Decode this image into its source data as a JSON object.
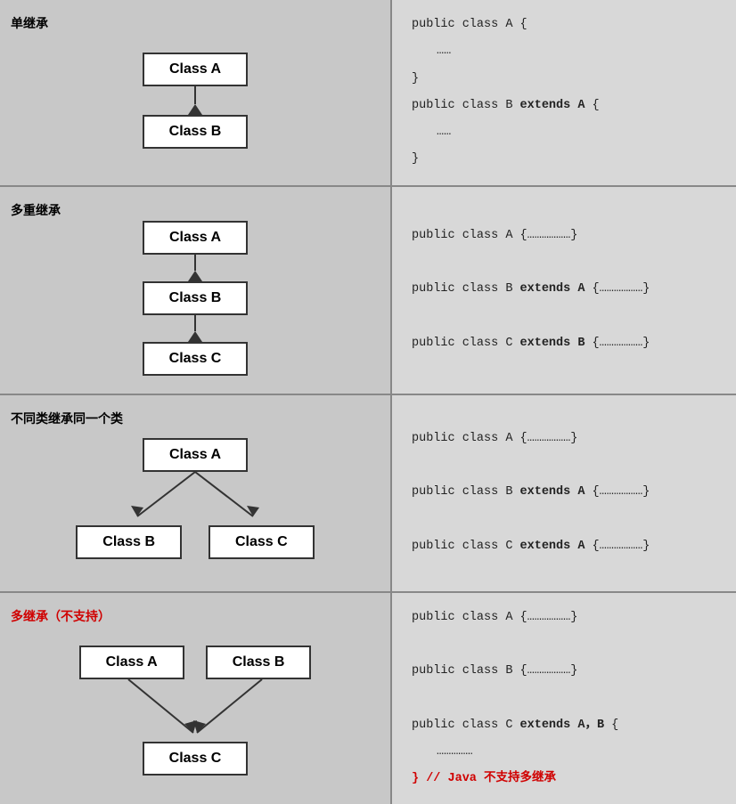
{
  "sections": [
    {
      "id": "single-inherit",
      "label": "单继承",
      "labelClass": "",
      "diagram_type": "single",
      "boxes": [
        "Class A",
        "Class B"
      ],
      "code_lines": [
        {
          "text": "public class A {",
          "bold_parts": [],
          "indent": false
        },
        {
          "text": "……",
          "bold_parts": [],
          "indent": true
        },
        {
          "text": "}",
          "bold_parts": [],
          "indent": false
        },
        {
          "text": "public class B extends A {",
          "bold_parts": [
            "extends A"
          ],
          "indent": false
        },
        {
          "text": "……",
          "bold_parts": [],
          "indent": true
        },
        {
          "text": "}",
          "bold_parts": [],
          "indent": false
        }
      ]
    },
    {
      "id": "multi-level-inherit",
      "label": "多重继承",
      "labelClass": "",
      "diagram_type": "chain",
      "boxes": [
        "Class A",
        "Class B",
        "Class C"
      ],
      "code_lines": [
        {
          "text": "public class A {………………}",
          "bold_parts": [],
          "indent": false
        },
        {
          "text": "",
          "bold_parts": [],
          "indent": false
        },
        {
          "text": "public class B extends A {………………}",
          "bold_parts": [
            "extends A"
          ],
          "indent": false
        },
        {
          "text": "",
          "bold_parts": [],
          "indent": false
        },
        {
          "text": "public class C extends B {………………}",
          "bold_parts": [
            "extends B"
          ],
          "indent": false
        }
      ]
    },
    {
      "id": "different-inherit-same",
      "label": "不同类继承同一个类",
      "labelClass": "",
      "diagram_type": "fan_out",
      "top_box": "Class A",
      "bottom_boxes": [
        "Class B",
        "Class C"
      ],
      "code_lines": [
        {
          "text": "public class A {………………}",
          "bold_parts": [],
          "indent": false
        },
        {
          "text": "",
          "bold_parts": [],
          "indent": false
        },
        {
          "text": "public class B extends A {………………}",
          "bold_parts": [
            "extends A"
          ],
          "indent": false
        },
        {
          "text": "",
          "bold_parts": [],
          "indent": false
        },
        {
          "text": "public class C extends A {………………}",
          "bold_parts": [
            "extends A"
          ],
          "indent": false
        }
      ]
    },
    {
      "id": "multi-inherit-unsupported",
      "label": "多继承（不支持）",
      "labelClass": "red",
      "diagram_type": "fan_in",
      "top_boxes": [
        "Class A",
        "Class B"
      ],
      "bottom_box": "Class C",
      "code_lines": [
        {
          "text": "public class A {………………}",
          "bold_parts": [],
          "indent": false
        },
        {
          "text": "",
          "bold_parts": [],
          "indent": false
        },
        {
          "text": "public class B {………………}",
          "bold_parts": [],
          "indent": false
        },
        {
          "text": "",
          "bold_parts": [],
          "indent": false
        },
        {
          "text": "public class C extends A，B {",
          "bold_parts": [
            "extends A，B"
          ],
          "indent": false
        },
        {
          "text": "……………",
          "bold_parts": [],
          "indent": true
        },
        {
          "text": "} // Java 不支持多继承",
          "bold_parts": [],
          "indent": false,
          "red": true
        }
      ]
    }
  ]
}
